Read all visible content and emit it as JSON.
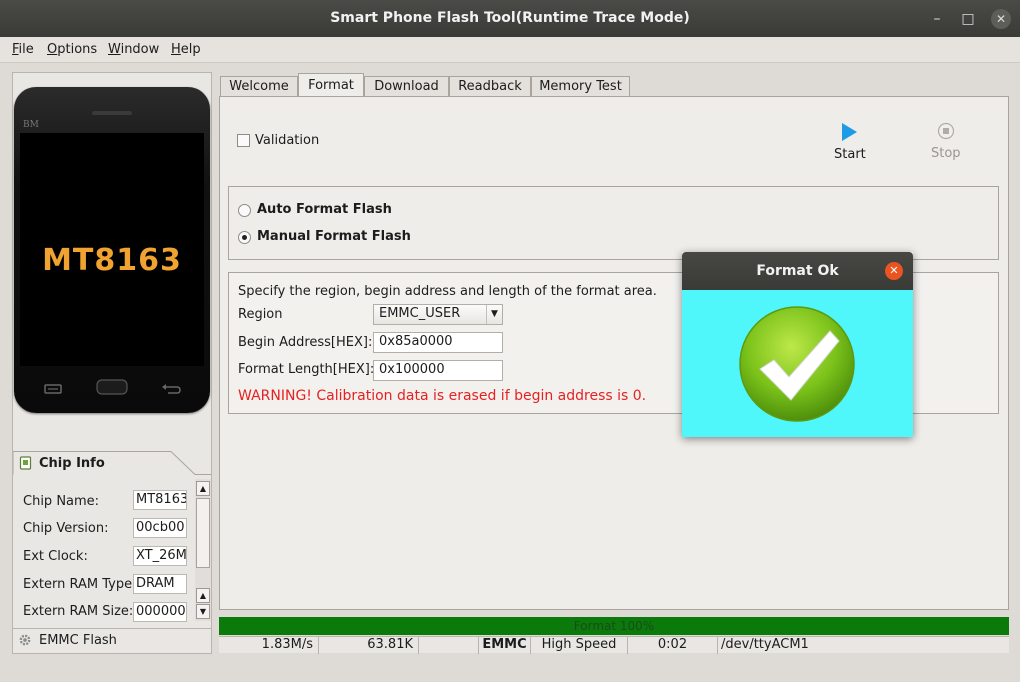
{
  "window": {
    "title": "Smart Phone Flash Tool(Runtime Trace Mode)"
  },
  "menu": [
    {
      "first": "F",
      "rest": "ile"
    },
    {
      "first": "O",
      "rest": "ptions"
    },
    {
      "first": "W",
      "rest": "indow"
    },
    {
      "first": "H",
      "rest": "elp"
    }
  ],
  "phone": {
    "brand_mark": "BM",
    "chip_label": "MT8163"
  },
  "chip_info": {
    "title": "Chip Info",
    "rows": [
      {
        "label": "Chip Name:",
        "value": "MT8163"
      },
      {
        "label": "Chip Version:",
        "value": "00cb00"
      },
      {
        "label": "Ext Clock:",
        "value": "XT_26M"
      },
      {
        "label": "Extern RAM Type:",
        "value": "DRAM"
      },
      {
        "label": "Extern RAM Size:",
        "value": "000000"
      }
    ],
    "emmc_tab": "EMMC Flash"
  },
  "tabs": [
    "Welcome",
    "Format",
    "Download",
    "Readback",
    "Memory Test"
  ],
  "active_tab": "Format",
  "format": {
    "validation_label": "Validation",
    "validation_checked": false,
    "start_label": "Start",
    "stop_label": "Stop",
    "auto_label": "Auto Format Flash",
    "manual_label": "Manual Format Flash",
    "selected_mode": "manual",
    "instructions": "Specify the region, begin address and length of the format area.",
    "region_label": "Region",
    "region_value": "EMMC_USER",
    "begin_label": "Begin Address[HEX]:",
    "begin_value": "0x85a0000",
    "length_label": "Format Length[HEX]:",
    "length_value": "0x100000",
    "warning": "WARNING! Calibration data is erased if begin address is 0."
  },
  "status": {
    "progress_text": "Format 100%",
    "progress_percent": 100,
    "speed": "1.83M/s",
    "size": "63.81K",
    "storage": "EMMC",
    "usb_speed": "High Speed",
    "time": "0:02",
    "port": "/dev/ttyACM1"
  },
  "dialog": {
    "title": "Format Ok"
  },
  "colors": {
    "progress_fill": "#0a7a0a",
    "dialog_body": "#4ff7fb",
    "warning_text": "#e52222",
    "start_icon": "#1e9be6",
    "dialog_close": "#e95420",
    "check_green": "#7bc21a"
  },
  "icons": {
    "start": "play-icon",
    "stop": "stop-icon",
    "chip": "chip-icon",
    "emmc": "gear-icon",
    "dialog_image": "checkmark-icon"
  }
}
